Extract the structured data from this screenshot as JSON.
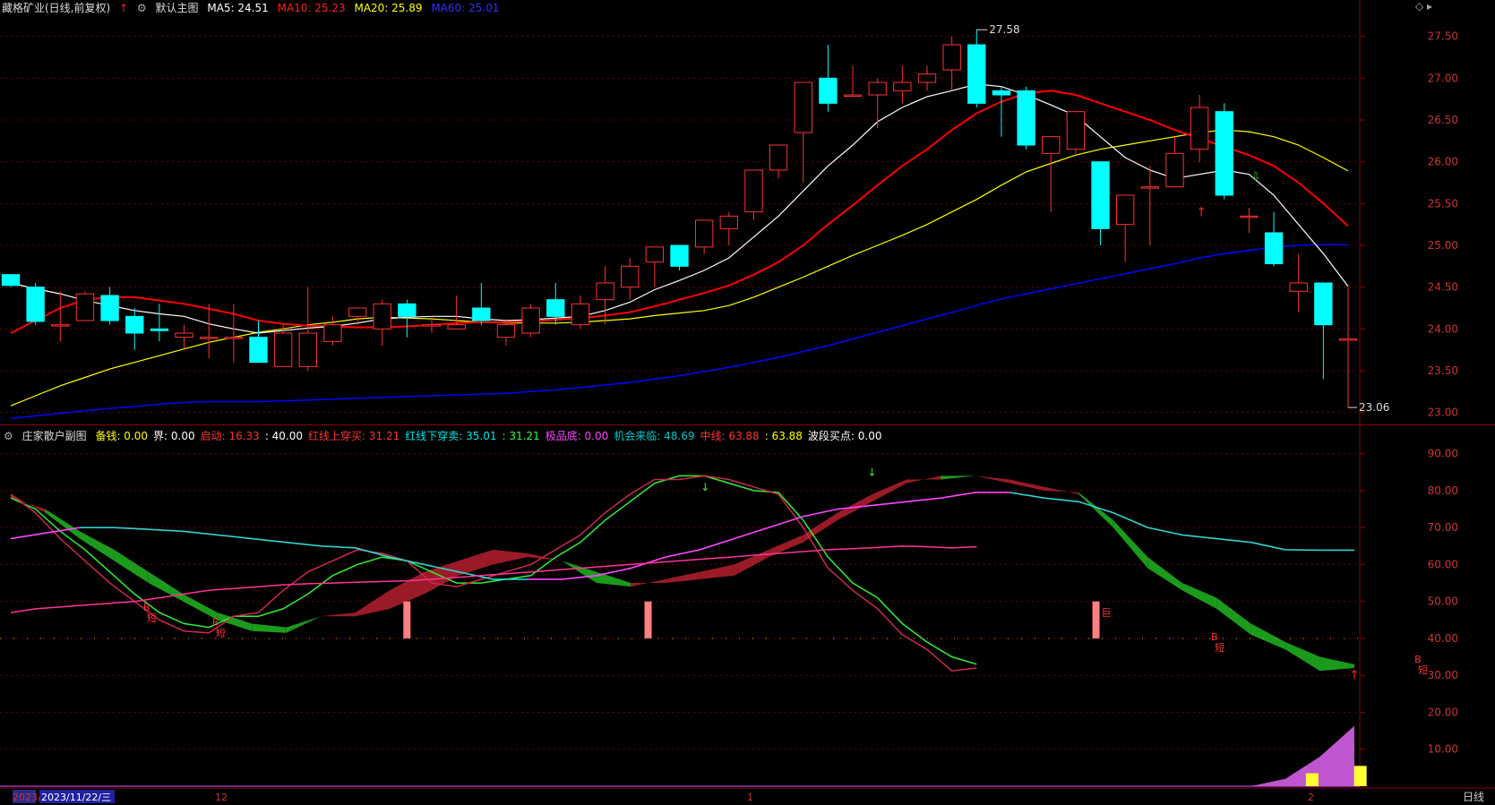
{
  "main_header": {
    "title": "藏格矿业(日线,前复权)",
    "main_label": "默认主图",
    "ma5": "MA5: 24.51",
    "ma10": "MA10: 25.23",
    "ma20": "MA20: 25.89",
    "ma60": "MA60: 25.01"
  },
  "sub_header": {
    "title": "庄家散户副图",
    "items": [
      {
        "text": "备钱: 0.00",
        "color": "#ffff00"
      },
      {
        "text": "界: 0.00",
        "color": "#ffffff"
      },
      {
        "text": "启动: 16.33",
        "color": "#ff3333"
      },
      {
        "text": ": 40.00",
        "color": "#ffffff"
      },
      {
        "text": "红线上穿买: 31.21",
        "color": "#ff3333"
      },
      {
        "text": "红线下穿卖: 35.01",
        "color": "#00e5e5"
      },
      {
        "text": ": 31.21",
        "color": "#33ff33"
      },
      {
        "text": "极品底: 0.00",
        "color": "#ff44ff"
      },
      {
        "text": "机会来临: 48.69",
        "color": "#00c8c8"
      },
      {
        "text": "中线: 63.88",
        "color": "#ff3333"
      },
      {
        "text": ": 63.88",
        "color": "#ffff00"
      },
      {
        "text": "波段买点: 0.00",
        "color": "#ffffff"
      }
    ]
  },
  "price_axis": [
    "27.50",
    "27.00",
    "26.50",
    "26.00",
    "25.50",
    "25.00",
    "24.50",
    "24.00",
    "23.50",
    "23.00"
  ],
  "ind_axis": [
    "90.00",
    "80.00",
    "70.00",
    "60.00",
    "50.00",
    "40.00",
    "30.00",
    "20.00",
    "10.00"
  ],
  "annotations": {
    "high": "27.58",
    "low": "23.06"
  },
  "signals": {
    "b": "B",
    "short": "短",
    "eq": "巨"
  },
  "bottom_bar": {
    "year_stub": "2023/",
    "cursor_date": "2023/11/22/三",
    "month_12": "12",
    "month_1": "1",
    "month_2": "2",
    "period": "日线"
  },
  "colors": {
    "up": "#ff3232",
    "down": "#00ffff",
    "ma5": "#ffffff",
    "ma10": "#ff0000",
    "ma20": "#ffff00",
    "ma60": "#0000ff"
  },
  "chart_data": [
    {
      "type": "candlestick",
      "panel": "main",
      "ylim": [
        22.9,
        27.7
      ],
      "ohlc": [
        [
          24.65,
          24.65,
          24.52,
          24.5
        ],
        [
          24.5,
          24.55,
          24.09,
          24.05
        ],
        [
          24.05,
          24.45,
          24.05,
          23.85
        ],
        [
          24.1,
          24.45,
          24.42,
          24.1
        ],
        [
          24.4,
          24.5,
          24.1,
          24.05
        ],
        [
          24.15,
          24.25,
          23.95,
          23.75
        ],
        [
          24.0,
          24.3,
          23.98,
          23.85
        ],
        [
          23.9,
          24.05,
          23.95,
          23.75
        ],
        [
          23.9,
          24.3,
          23.9,
          23.65
        ],
        [
          23.9,
          24.3,
          23.9,
          23.6
        ],
        [
          23.9,
          24.1,
          23.6,
          23.6
        ],
        [
          23.55,
          24.05,
          23.95,
          23.55
        ],
        [
          23.55,
          24.5,
          23.95,
          23.5
        ],
        [
          23.85,
          24.15,
          24.05,
          23.8
        ],
        [
          24.15,
          24.25,
          24.25,
          24.05
        ],
        [
          24.0,
          24.35,
          24.3,
          23.8
        ],
        [
          24.3,
          24.35,
          24.15,
          23.9
        ],
        [
          24.05,
          24.15,
          24.05,
          23.95
        ],
        [
          24.0,
          24.4,
          24.05,
          24.0
        ],
        [
          24.25,
          24.55,
          24.1,
          24.05
        ],
        [
          23.9,
          24.1,
          24.05,
          23.8
        ],
        [
          23.95,
          24.3,
          24.25,
          23.9
        ],
        [
          24.35,
          24.55,
          24.15,
          24.05
        ],
        [
          24.05,
          24.4,
          24.3,
          24.0
        ],
        [
          24.35,
          24.75,
          24.55,
          24.05
        ],
        [
          24.5,
          24.85,
          24.75,
          24.35
        ],
        [
          24.8,
          24.95,
          24.98,
          24.5
        ],
        [
          25.0,
          25.0,
          24.75,
          24.7
        ],
        [
          24.98,
          25.3,
          25.3,
          24.9
        ],
        [
          25.2,
          25.4,
          25.35,
          25.0
        ],
        [
          25.4,
          25.9,
          25.9,
          25.3
        ],
        [
          25.9,
          26.2,
          26.2,
          25.8
        ],
        [
          26.35,
          26.95,
          26.95,
          25.75
        ],
        [
          27.0,
          27.4,
          26.7,
          26.6
        ],
        [
          26.8,
          27.15,
          26.8,
          26.8
        ],
        [
          26.8,
          27.0,
          26.95,
          26.4
        ],
        [
          26.85,
          27.15,
          26.95,
          26.7
        ],
        [
          26.95,
          27.15,
          27.05,
          26.85
        ],
        [
          27.1,
          27.5,
          27.4,
          26.85
        ],
        [
          27.4,
          27.58,
          26.7,
          26.65
        ],
        [
          26.85,
          26.9,
          26.8,
          26.3
        ],
        [
          26.85,
          26.9,
          26.2,
          26.15
        ],
        [
          26.1,
          26.3,
          26.3,
          25.4
        ],
        [
          26.15,
          26.5,
          26.6,
          26.1
        ],
        [
          26.0,
          26.0,
          25.2,
          25.0
        ],
        [
          25.25,
          25.6,
          25.6,
          24.8
        ],
        [
          25.7,
          25.95,
          25.7,
          25.0
        ],
        [
          25.7,
          26.3,
          26.1,
          25.7
        ],
        [
          26.15,
          26.8,
          26.65,
          26.0
        ],
        [
          26.6,
          26.7,
          25.6,
          25.55
        ],
        [
          25.35,
          25.45,
          25.35,
          25.15
        ],
        [
          25.15,
          25.4,
          24.78,
          24.75
        ],
        [
          24.45,
          24.9,
          24.55,
          24.2
        ],
        [
          24.55,
          24.55,
          24.05,
          23.4
        ],
        [
          23.88,
          24.5,
          23.88,
          23.06
        ]
      ],
      "ma": {
        "MA5": [
          24.55,
          24.48,
          24.42,
          24.34,
          24.28,
          24.22,
          24.18,
          24.15,
          24.06,
          24.0,
          23.95,
          23.98,
          24.01,
          24.03,
          24.07,
          24.12,
          24.14,
          24.15,
          24.15,
          24.12,
          24.1,
          24.11,
          24.13,
          24.15,
          24.22,
          24.32,
          24.47,
          24.58,
          24.7,
          24.85,
          25.1,
          25.35,
          25.65,
          25.95,
          26.2,
          26.48,
          26.65,
          26.78,
          26.85,
          26.93,
          26.9,
          26.8,
          26.68,
          26.55,
          26.3,
          26.05,
          25.9,
          25.8,
          25.85,
          25.9,
          25.85,
          25.6,
          25.25,
          24.9,
          24.51
        ],
        "MA10": [
          23.95,
          24.1,
          24.25,
          24.35,
          24.38,
          24.38,
          24.34,
          24.3,
          24.24,
          24.18,
          24.1,
          24.06,
          24.04,
          24.03,
          24.02,
          24.02,
          24.03,
          24.05,
          24.07,
          24.08,
          24.08,
          24.09,
          24.11,
          24.13,
          24.16,
          24.2,
          24.27,
          24.35,
          24.43,
          24.52,
          24.65,
          24.8,
          25.0,
          25.25,
          25.48,
          25.72,
          25.95,
          26.15,
          26.38,
          26.58,
          26.72,
          26.82,
          26.85,
          26.8,
          26.7,
          26.6,
          26.5,
          26.38,
          26.28,
          26.18,
          26.08,
          25.95,
          25.75,
          25.5,
          25.23
        ],
        "MA20": [
          23.08,
          23.2,
          23.32,
          23.42,
          23.52,
          23.6,
          23.68,
          23.76,
          23.84,
          23.9,
          23.96,
          24.0,
          24.05,
          24.08,
          24.12,
          24.14,
          24.13,
          24.12,
          24.1,
          24.08,
          24.07,
          24.07,
          24.07,
          24.08,
          24.1,
          24.12,
          24.16,
          24.19,
          24.22,
          24.28,
          24.38,
          24.5,
          24.62,
          24.75,
          24.88,
          25.0,
          25.12,
          25.25,
          25.4,
          25.55,
          25.72,
          25.88,
          25.98,
          26.08,
          26.15,
          26.2,
          26.25,
          26.3,
          26.35,
          26.38,
          26.36,
          26.3,
          26.2,
          26.05,
          25.89
        ],
        "MA60": [
          22.93,
          22.96,
          22.99,
          23.02,
          23.05,
          23.07,
          23.1,
          23.12,
          23.13,
          23.13,
          23.13,
          23.14,
          23.15,
          23.16,
          23.17,
          23.18,
          23.19,
          23.2,
          23.21,
          23.22,
          23.23,
          23.25,
          23.27,
          23.3,
          23.33,
          23.36,
          23.4,
          23.44,
          23.49,
          23.54,
          23.6,
          23.66,
          23.73,
          23.8,
          23.88,
          23.96,
          24.04,
          24.12,
          24.2,
          24.28,
          24.36,
          24.42,
          24.48,
          24.54,
          24.6,
          24.66,
          24.72,
          24.78,
          24.85,
          24.9,
          24.94,
          24.98,
          25.0,
          25.01,
          25.01
        ]
      }
    },
    {
      "type": "line",
      "panel": "indicator",
      "ylim": [
        0,
        95
      ],
      "series": [
        {
          "name": "中线",
          "values": [
            67,
            68.5,
            70,
            70,
            69.5,
            69,
            68,
            67,
            66,
            65,
            64.5,
            62,
            60,
            58,
            56,
            56,
            56,
            57,
            59,
            62,
            64,
            67,
            70,
            73,
            75,
            76,
            77,
            78,
            79.5,
            79.5,
            78,
            77,
            74,
            70,
            68,
            67,
            66,
            64,
            63.88,
            63.88
          ]
        },
        {
          "name": "红线下穿卖",
          "values": [
            78,
            75,
            69,
            64,
            58,
            52,
            47,
            44,
            43,
            46,
            46,
            48,
            52,
            57,
            60,
            62,
            61,
            58,
            55,
            55,
            56,
            57,
            62,
            66,
            72,
            77,
            82,
            84,
            84,
            82,
            80,
            79.5,
            72,
            62,
            55,
            51,
            44,
            39,
            35.01,
            33
          ]
        },
        {
          "name": "红线上穿买",
          "values": [
            79,
            74,
            67,
            61,
            55,
            50,
            45,
            42,
            41.5,
            46,
            47,
            53,
            58,
            61,
            64,
            63,
            61,
            55,
            54,
            56,
            58,
            60,
            64,
            68,
            74,
            79,
            83,
            83,
            84,
            83,
            81,
            79,
            70,
            59,
            53,
            48,
            41,
            37,
            31.21,
            32
          ]
        },
        {
          "name": "机会来临",
          "values": [
            47,
            48,
            48.5,
            49,
            49.5,
            50,
            51,
            52,
            53,
            53.5,
            54,
            54.5,
            54.8,
            55,
            55.2,
            55.4,
            55.6,
            56,
            56.5,
            57,
            57.5,
            58,
            58.5,
            59,
            59.5,
            60,
            60.5,
            61,
            61.5,
            62,
            62.5,
            63,
            63.5,
            64,
            64.3,
            64.6,
            65,
            64.8,
            64.5,
            64.8
          ]
        },
        {
          "name": "启动",
          "values": [
            0,
            0,
            0,
            0,
            0,
            0,
            0,
            0,
            0,
            0,
            0,
            0,
            0,
            0,
            0,
            0,
            0,
            0,
            0,
            0,
            0,
            0,
            0,
            0,
            0,
            0,
            0,
            0,
            0,
            0,
            0,
            0,
            0,
            0,
            0,
            0,
            2,
            8,
            13,
            16.33
          ]
        }
      ]
    }
  ]
}
